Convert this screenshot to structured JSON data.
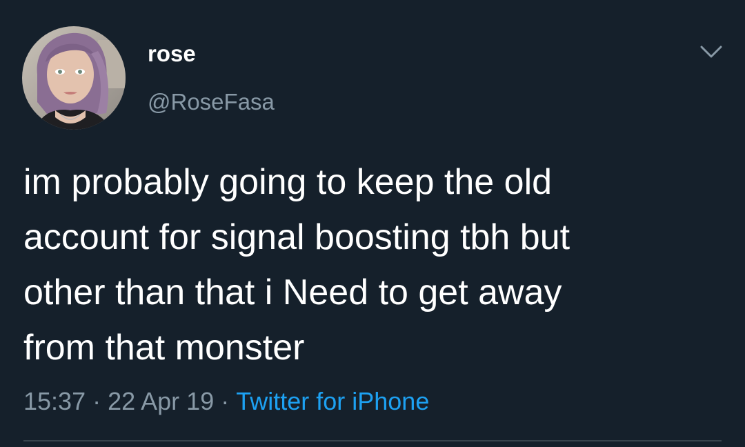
{
  "tweet": {
    "author": {
      "display_name": "rose",
      "handle": "@RoseFasa",
      "avatar_icon": "profile-photo"
    },
    "text": "im probably going to keep the old\naccount for signal boosting tbh but\nother than that i Need to get away\nfrom that monster",
    "time": "15:37",
    "separator": "·",
    "date": "22 Apr 19",
    "source": "Twitter for iPhone",
    "menu_icon": "chevron-down-icon"
  },
  "colors": {
    "background": "#15202b",
    "primary_text": "#ffffff",
    "secondary_text": "#8899a6",
    "link": "#1da1f2",
    "divider": "#38444d"
  }
}
